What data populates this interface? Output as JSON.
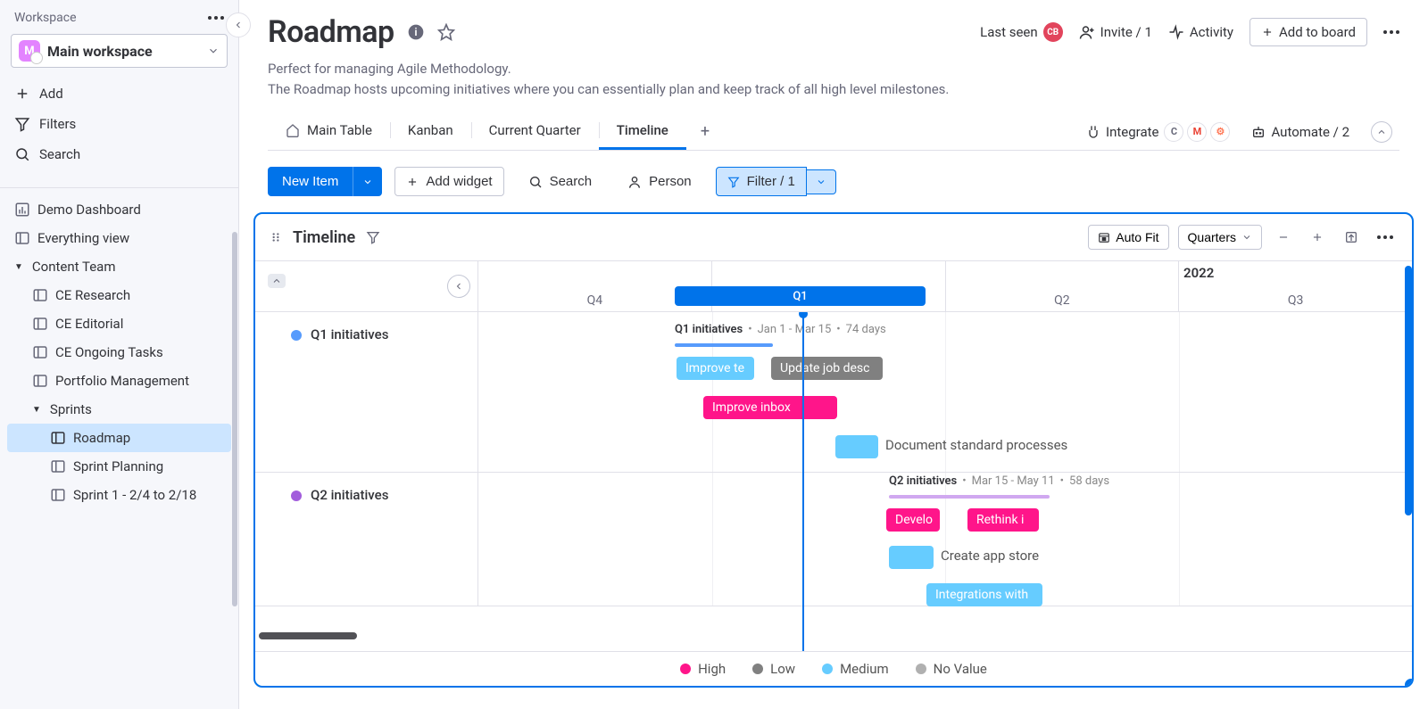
{
  "sidebar": {
    "header": "Workspace",
    "workspace": {
      "initial": "M",
      "name": "Main workspace"
    },
    "actions": {
      "add": "Add",
      "filters": "Filters",
      "search": "Search"
    },
    "nav": {
      "demo": "Demo Dashboard",
      "everything": "Everything view",
      "contentTeam": "Content Team",
      "ceResearch": "CE Research",
      "ceEditorial": "CE Editorial",
      "ceOngoing": "CE Ongoing Tasks",
      "portfolio": "Portfolio Management",
      "sprints": "Sprints",
      "roadmap": "Roadmap",
      "sprintPlanning": "Sprint Planning",
      "sprint1": "Sprint 1 - 2/4 to 2/18"
    }
  },
  "header": {
    "title": "Roadmap",
    "desc1": "Perfect for managing Agile Methodology.",
    "desc2": "The Roadmap hosts upcoming initiatives where you can essentially plan and keep track of all high level milestones.",
    "lastSeen": "Last seen",
    "lastSeenUser": "CB",
    "invite": "Invite / 1",
    "activity": "Activity",
    "addToBoard": "Add to board"
  },
  "tabs": {
    "main": "Main Table",
    "kanban": "Kanban",
    "current": "Current Quarter",
    "timeline": "Timeline",
    "integrate": "Integrate",
    "automate": "Automate / 2"
  },
  "toolbar": {
    "newItem": "New Item",
    "addWidget": "Add widget",
    "search": "Search",
    "person": "Person",
    "filter": "Filter / 1"
  },
  "panel": {
    "title": "Timeline",
    "autofit": "Auto Fit",
    "scale": "Quarters",
    "year": "2022",
    "quarters": {
      "q4": "Q4",
      "q1": "Q1",
      "q2": "Q2",
      "q3": "Q3"
    },
    "selectedQuarter": "Q1",
    "groups": {
      "q1": {
        "name": "Q1 initiatives",
        "range": "Jan 1 - Mar 15",
        "days": "74 days",
        "color": "#579bfc"
      },
      "q2": {
        "name": "Q2 initiatives",
        "range": "Mar 15 - May 11",
        "days": "58 days",
        "color": "#a25ddc"
      }
    },
    "tasks": {
      "improveTe": "Improve te",
      "updateJob": "Update job desc",
      "improveInbox": "Improve inbox",
      "documentStd": "Document standard processes",
      "develo": "Develo",
      "rethink": "Rethink i",
      "createApp": "Create app store",
      "integrations": "Integrations with"
    },
    "colors": {
      "high": "#e2445c",
      "low": "#808080",
      "medium": "#66ccff",
      "none": "#b0b0b0",
      "pink": "#ff158a"
    }
  },
  "legend": {
    "high": "High",
    "low": "Low",
    "medium": "Medium",
    "none": "No Value"
  }
}
